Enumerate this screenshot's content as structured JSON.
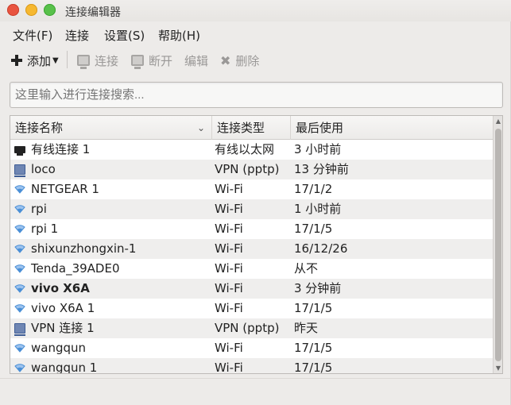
{
  "window": {
    "title": "连接编辑器"
  },
  "menubar": {
    "items": [
      "文件(F)",
      "连接",
      "设置(S)",
      "帮助(H)"
    ]
  },
  "toolbar": {
    "add_label": "添加",
    "connect_label": "连接",
    "disconnect_label": "断开",
    "edit_label": "编辑",
    "delete_label": "删除"
  },
  "search": {
    "placeholder": "这里输入进行连接搜索..."
  },
  "table": {
    "columns": [
      "连接名称",
      "连接类型",
      "最后使用"
    ],
    "rows": [
      {
        "icon": "wired-icon",
        "name": "有线连接 1",
        "type": "有线以太网",
        "last": "3 小时前",
        "bold": false
      },
      {
        "icon": "vpn-icon",
        "name": "loco",
        "type": "VPN (pptp)",
        "last": "13 分钟前",
        "bold": false
      },
      {
        "icon": "wifi-icon",
        "name": "NETGEAR 1",
        "type": "Wi-Fi",
        "last": "17/1/2",
        "bold": false
      },
      {
        "icon": "wifi-icon",
        "name": "rpi",
        "type": "Wi-Fi",
        "last": "1 小时前",
        "bold": false
      },
      {
        "icon": "wifi-icon",
        "name": "rpi 1",
        "type": "Wi-Fi",
        "last": "17/1/5",
        "bold": false
      },
      {
        "icon": "wifi-icon",
        "name": "shixunzhongxin-1",
        "type": "Wi-Fi",
        "last": "16/12/26",
        "bold": false
      },
      {
        "icon": "wifi-icon",
        "name": "Tenda_39ADE0",
        "type": "Wi-Fi",
        "last": "从不",
        "bold": false
      },
      {
        "icon": "wifi-icon",
        "name": "vivo X6A",
        "type": "Wi-Fi",
        "last": "3 分钟前",
        "bold": true
      },
      {
        "icon": "wifi-icon",
        "name": "vivo X6A 1",
        "type": "Wi-Fi",
        "last": "17/1/5",
        "bold": false
      },
      {
        "icon": "vpn-icon",
        "name": "VPN 连接 1",
        "type": "VPN (pptp)",
        "last": "昨天",
        "bold": false
      },
      {
        "icon": "wifi-icon",
        "name": "wangqun",
        "type": "Wi-Fi",
        "last": "17/1/5",
        "bold": false
      },
      {
        "icon": "wifi-icon",
        "name": "wangqun 1",
        "type": "Wi-Fi",
        "last": "17/1/5",
        "bold": false
      }
    ]
  },
  "colors": {
    "close": "#e9543f",
    "minimize": "#f6b830",
    "maximize": "#58c14a",
    "vpn": "#6f86b3",
    "wifi": "#4a8fd6"
  }
}
